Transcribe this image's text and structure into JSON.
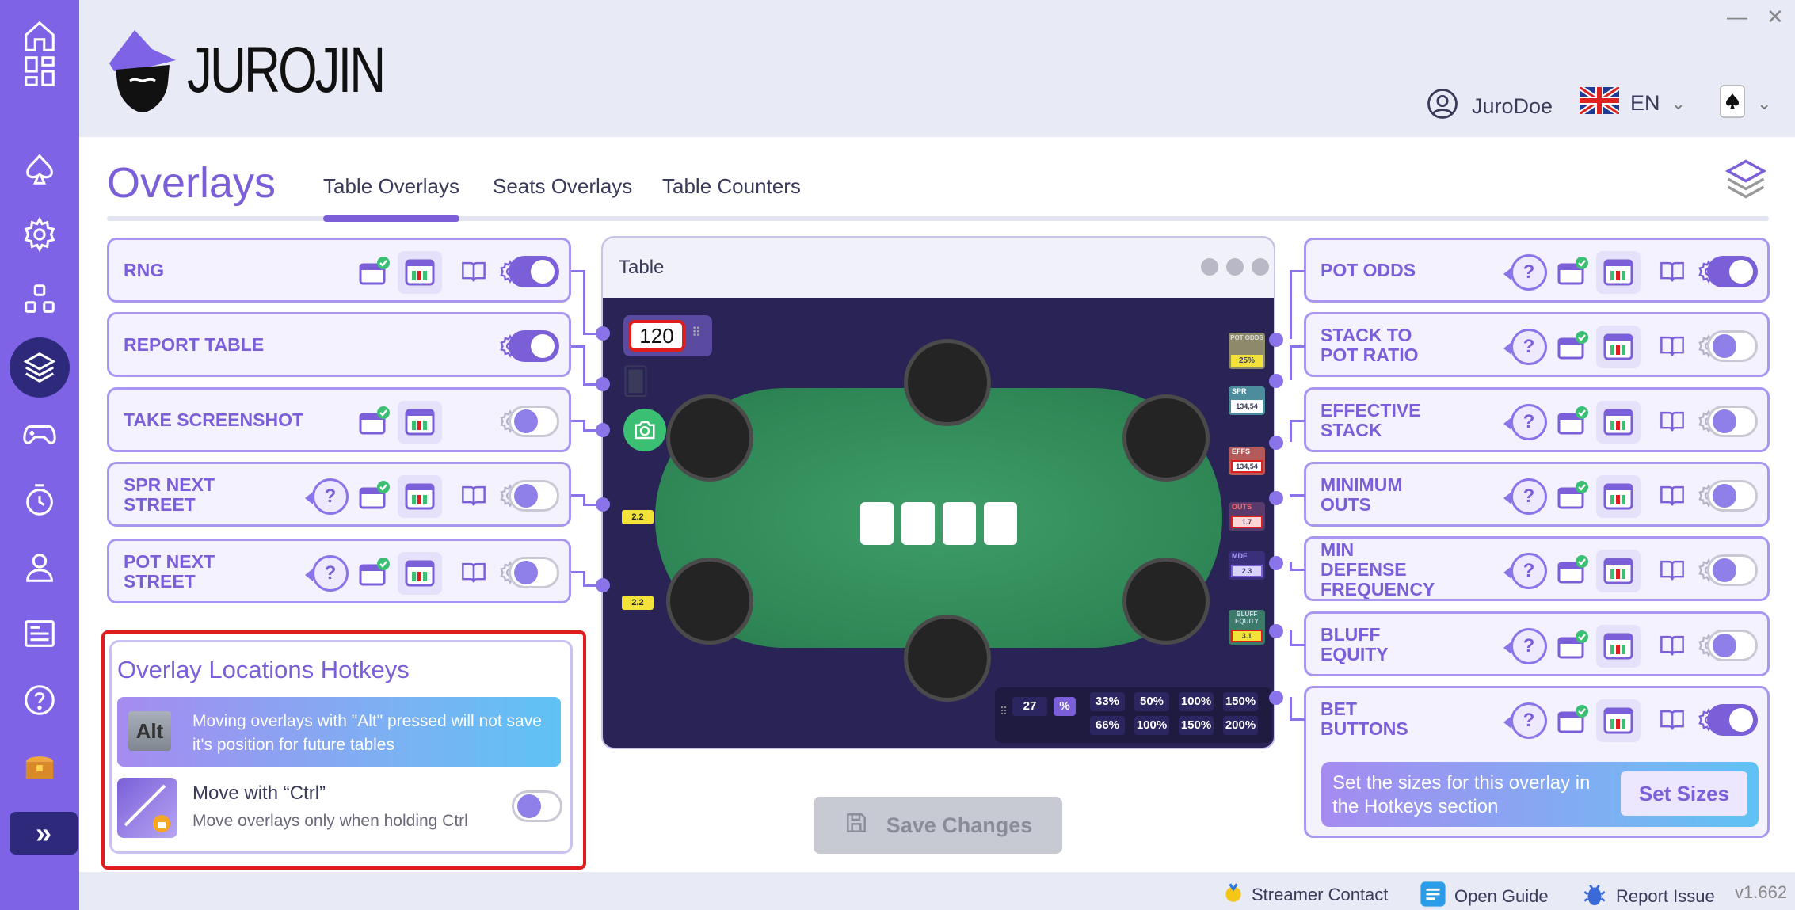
{
  "app": {
    "logo_text": "JUROJIN",
    "version": "v1.662"
  },
  "header": {
    "username": "JuroDoe",
    "language": "EN"
  },
  "page": {
    "title": "Overlays",
    "tabs": [
      {
        "label": "Table Overlays",
        "active": true
      },
      {
        "label": "Seats Overlays",
        "active": false
      },
      {
        "label": "Table Counters",
        "active": false
      }
    ]
  },
  "left_overlays": [
    {
      "label": "RNG",
      "enabled": true
    },
    {
      "label": "REPORT TABLE",
      "enabled": true
    },
    {
      "label": "TAKE SCREENSHOT",
      "enabled": false
    },
    {
      "label": "SPR NEXT\nSTREET",
      "enabled": false
    },
    {
      "label": "POT NEXT\nSTREET",
      "enabled": false
    }
  ],
  "right_overlays": [
    {
      "label": "POT ODDS",
      "enabled": true
    },
    {
      "label": "STACK TO\nPOT RATIO",
      "enabled": false
    },
    {
      "label": "EFFECTIVE\nSTACK",
      "enabled": false
    },
    {
      "label": "MINIMUM\nOUTS",
      "enabled": false
    },
    {
      "label": "MIN\nDEFENSE\nFREQUENCY",
      "enabled": false
    },
    {
      "label": "BLUFF\nEQUITY",
      "enabled": false
    },
    {
      "label": "BET\nBUTTONS",
      "enabled": true
    }
  ],
  "table_preview": {
    "title": "Table",
    "rng_value": "120",
    "chip_values": [
      "2.2",
      "2.2"
    ],
    "hud": {
      "pot_odds_label": "POT ODDS",
      "pot_odds_value": "25%",
      "spr_label": "SPR",
      "spr_value": "134,54",
      "effs_label": "EFFS",
      "effs_value": "134,54",
      "outs_label": "OUTS",
      "outs_value": "1.7",
      "mdf_label": "MDF",
      "mdf_value": "2.3",
      "bluff_label": "BLUFF EQUITY",
      "bluff_value": "3.1"
    },
    "bet_input": "27",
    "bet_unit": "%",
    "bet_sizes_row1": [
      "33%",
      "50%",
      "100%",
      "150%"
    ],
    "bet_sizes_row2": [
      "66%",
      "100%",
      "150%",
      "200%"
    ]
  },
  "hotkeys": {
    "title": "Overlay Locations Hotkeys",
    "alt_key": "Alt",
    "alt_text": "Moving overlays with \"Alt\" pressed will not save it's position for future tables",
    "ctrl_title": "Move with “Ctrl”",
    "ctrl_sub": "Move overlays only when holding Ctrl",
    "ctrl_enabled": false
  },
  "save_button": "Save Changes",
  "sizes": {
    "text": "Set the sizes for this overlay in the Hotkeys section",
    "button": "Set Sizes"
  },
  "footer": {
    "streamer": "Streamer Contact",
    "guide": "Open Guide",
    "report": "Report Issue"
  },
  "colors": {
    "accent": "#7a5fd8",
    "sidebar": "#7e63e6",
    "sidebar_active": "#2d2a7c",
    "highlight": "#e01d1d"
  }
}
